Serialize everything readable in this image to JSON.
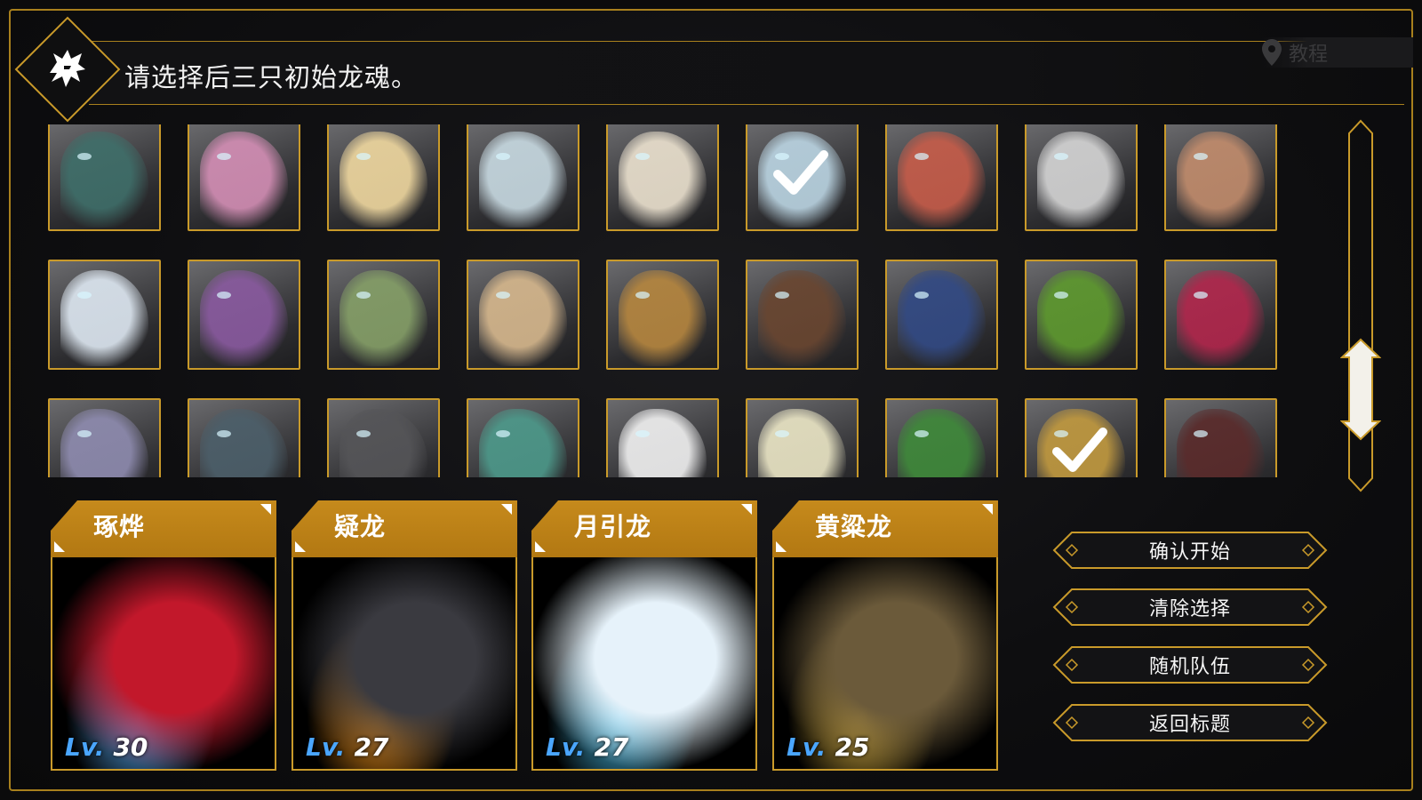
{
  "header": {
    "title": "请选择后三只初始龙魂。",
    "tutorial_label": "教程"
  },
  "grid": {
    "rows": [
      [
        {
          "name": "teal-dragon",
          "color": "#3f6f6a",
          "selected": false
        },
        {
          "name": "pink-dragon",
          "color": "#d58fb6",
          "selected": false
        },
        {
          "name": "golden-halo-dragon",
          "color": "#f1d9a0",
          "selected": false
        },
        {
          "name": "ice-crystal-dragon",
          "color": "#c9dbe3",
          "selected": false
        },
        {
          "name": "white-horned-dragon",
          "color": "#ede3d0",
          "selected": false
        },
        {
          "name": "frost-wing-dragon",
          "color": "#bcd6e4",
          "selected": true
        },
        {
          "name": "red-serpent-dragon",
          "color": "#c85d4a",
          "selected": false
        },
        {
          "name": "silver-spike-dragon",
          "color": "#d6d6d6",
          "selected": false
        },
        {
          "name": "copper-dragon",
          "color": "#c38d6d",
          "selected": false
        }
      ],
      [
        {
          "name": "white-blue-dragon",
          "color": "#dfe9f3",
          "selected": false
        },
        {
          "name": "violet-dragon",
          "color": "#8a5aa0",
          "selected": false
        },
        {
          "name": "green-leaf-dragon",
          "color": "#86a068",
          "selected": false
        },
        {
          "name": "feather-dragon",
          "color": "#d8b98e",
          "selected": false
        },
        {
          "name": "antler-gold-dragon",
          "color": "#b7873f",
          "selected": false
        },
        {
          "name": "brown-ram-dragon",
          "color": "#6a4630",
          "selected": false
        },
        {
          "name": "navy-dragon",
          "color": "#324a85",
          "selected": false
        },
        {
          "name": "emerald-orb-dragon",
          "color": "#5e9a2e",
          "selected": false
        },
        {
          "name": "neon-fire-dragon",
          "color": "#b2264c",
          "selected": false
        }
      ],
      [
        {
          "name": "armored-gold-dragon",
          "color": "#8f8cb0",
          "selected": false
        },
        {
          "name": "dark-fish-dragon",
          "color": "#4c5f6a",
          "selected": false
        },
        {
          "name": "gray-cat-dragon",
          "color": "#555558",
          "selected": false
        },
        {
          "name": "teal-gold-dragon",
          "color": "#4d9a8b",
          "selected": false
        },
        {
          "name": "white-wyrm-dragon",
          "color": "#f2f2f2",
          "selected": false
        },
        {
          "name": "cream-dragon",
          "color": "#ece7c6",
          "selected": false
        },
        {
          "name": "green-wyvern-dragon",
          "color": "#3f8a3a",
          "selected": false
        },
        {
          "name": "gold-antler-dragon",
          "color": "#c29a3f",
          "selected": true
        },
        {
          "name": "crimson-dark-dragon",
          "color": "#5a2a2a",
          "selected": false
        }
      ]
    ]
  },
  "team": [
    {
      "name": "琢烨",
      "level_prefix": "Lv.",
      "level": "30",
      "color": "#c2182b",
      "accent": "#5fb5ff"
    },
    {
      "name": "疑龙",
      "level_prefix": "Lv.",
      "level": "27",
      "color": "#3a3a40",
      "accent": "#ff9a1a"
    },
    {
      "name": "月引龙",
      "level_prefix": "Lv.",
      "level": "27",
      "color": "#e6f2fa",
      "accent": "#4cc3ee"
    },
    {
      "name": "黄粱龙",
      "level_prefix": "Lv.",
      "level": "25",
      "color": "#6b5a3a",
      "accent": "#d8b040"
    }
  ],
  "actions": {
    "confirm": "确认开始",
    "clear": "清除选择",
    "random": "随机队伍",
    "back": "返回标题"
  },
  "colors": {
    "gold": "#c99a2a",
    "tab_gold": "#c68a1c",
    "level_blue": "#4aa6ff"
  },
  "icons": {
    "emblem": "dragon-head-icon",
    "tutorial": "location-pin-icon",
    "selected": "check-icon",
    "scroll": "scroll-thumb-icon"
  }
}
